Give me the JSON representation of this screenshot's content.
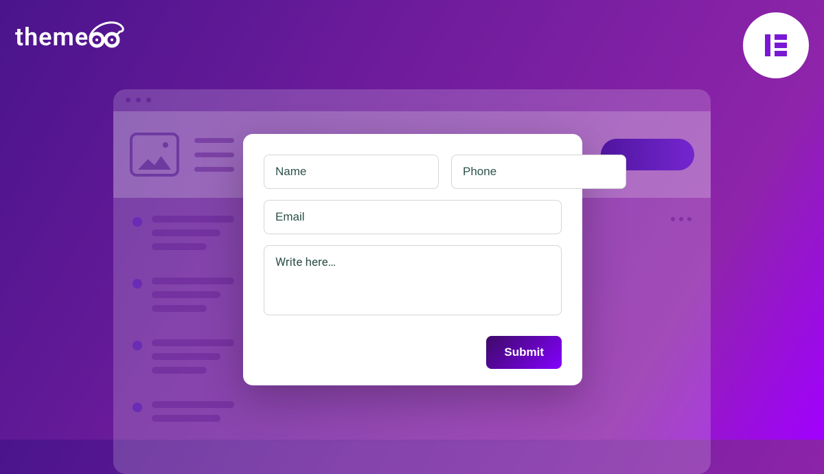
{
  "brand": {
    "name": "theme"
  },
  "badge": {
    "icon": "elementor-icon"
  },
  "form": {
    "name_placeholder": "Name",
    "phone_placeholder": "Phone",
    "email_placeholder": "Email",
    "message_placeholder": "Write here…",
    "submit_label": "Submit"
  }
}
